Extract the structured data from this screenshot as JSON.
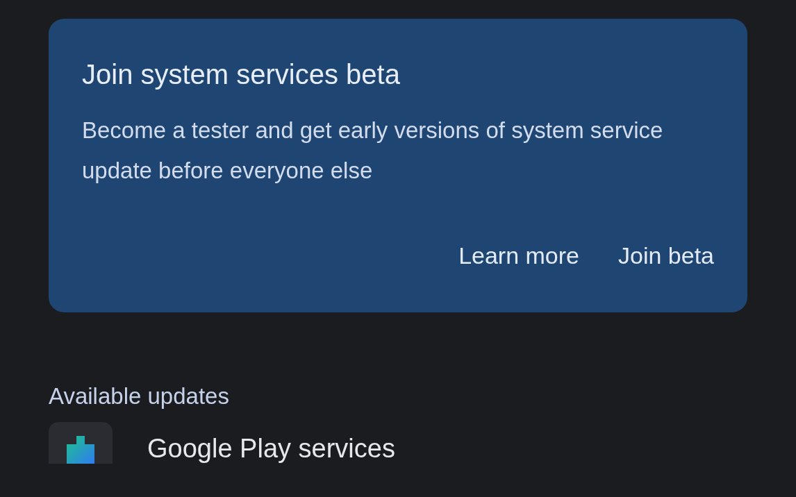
{
  "beta_card": {
    "title": "Join system services beta",
    "description": "Become a tester and get early versions of system service update before everyone else",
    "buttons": [
      "Learn more",
      "Join beta"
    ]
  },
  "available_updates": {
    "heading": "Available updates",
    "items": [
      {
        "name": "Google Play services"
      }
    ]
  }
}
